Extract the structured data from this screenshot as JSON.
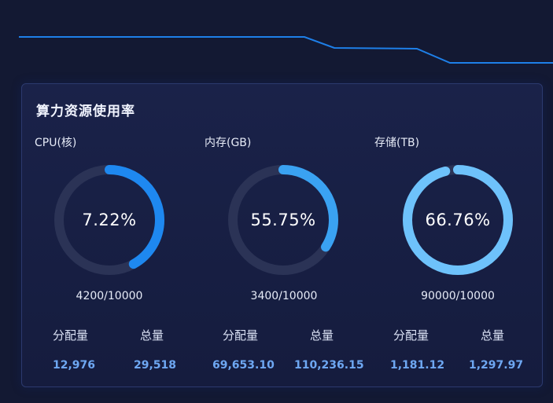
{
  "panel": {
    "title": "算力资源使用率"
  },
  "colors": {
    "background": "#131933",
    "panel_border": "#2c3a6e",
    "header_line": "#1e7fe8",
    "ring_track": "#2b3356",
    "ring_cpu": "#1e88f0",
    "ring_memory": "#3aa2f2",
    "ring_storage": "#6ec2fb",
    "value_text": "#6ea7f2"
  },
  "cards": [
    {
      "label": "CPU(核)",
      "percent_text": "7.22%",
      "percent": 0.42,
      "ratio": "4200/10000",
      "allocated_label": "分配量",
      "total_label": "总量",
      "allocated_value": "12,976",
      "total_value": "29,518"
    },
    {
      "label": "内存(GB)",
      "percent_text": "55.75%",
      "percent": 0.34,
      "ratio": "3400/10000",
      "allocated_label": "分配量",
      "total_label": "总量",
      "allocated_value": "69,653.10",
      "total_value": "110,236.15"
    },
    {
      "label": "存储(TB)",
      "percent_text": "66.76%",
      "percent": 0.96,
      "ratio": "90000/10000",
      "allocated_label": "分配量",
      "total_label": "总量",
      "allocated_value": "1,181.12",
      "total_value": "1,297.97"
    }
  ]
}
